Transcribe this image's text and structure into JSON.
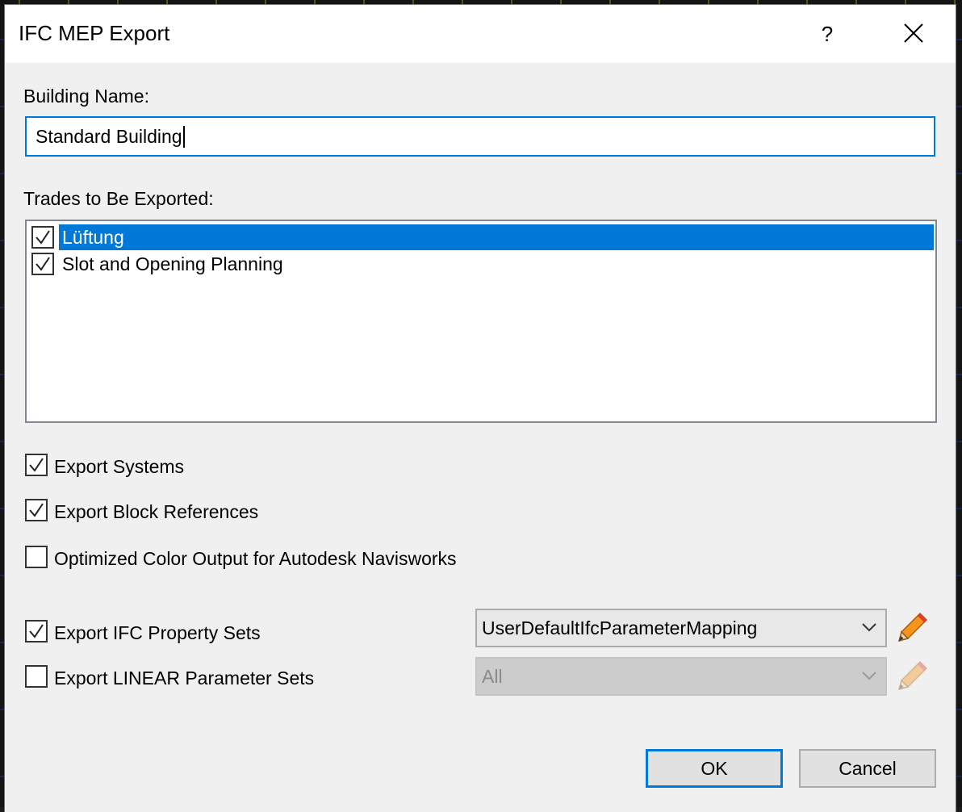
{
  "window": {
    "title": "IFC MEP Export",
    "help_label": "?",
    "close_icon": "close-icon"
  },
  "building": {
    "label": "Building Name:",
    "value": "Standard Building"
  },
  "trades": {
    "label": "Trades to Be Exported:",
    "items": [
      {
        "label": "Lüftung",
        "checked": true,
        "selected": true
      },
      {
        "label": "Slot and Opening Planning",
        "checked": true,
        "selected": false
      }
    ]
  },
  "options": {
    "export_systems": {
      "label": "Export Systems",
      "checked": true
    },
    "export_block_refs": {
      "label": "Export Block References",
      "checked": true
    },
    "optimized_color": {
      "label": "Optimized Color Output for Autodesk Navisworks",
      "checked": false
    },
    "export_ifc_psets": {
      "label": "Export IFC Property Sets",
      "checked": true
    },
    "export_linear_psets": {
      "label": "Export LINEAR Parameter Sets",
      "checked": false
    }
  },
  "ifc_mapping": {
    "value": "UserDefaultIfcParameterMapping",
    "enabled": true,
    "edit_icon": "pencil-icon"
  },
  "linear_sets": {
    "value": "All",
    "enabled": false,
    "edit_icon": "pencil-icon"
  },
  "buttons": {
    "ok": "OK",
    "cancel": "Cancel"
  },
  "colors": {
    "accent": "#0078d7",
    "selection": "#0078d7",
    "dialog_bg": "#f0f0f0",
    "pencil_body": "#f7941d",
    "pencil_tip": "#e53935"
  }
}
